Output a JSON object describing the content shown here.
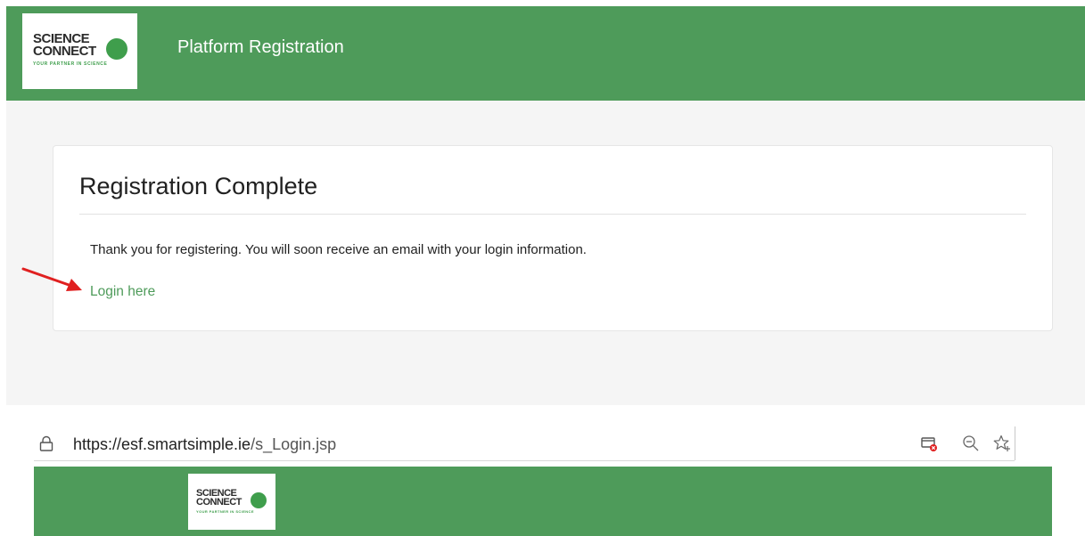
{
  "registration_page": {
    "header_title": "Platform Registration",
    "logo": {
      "line1": "SCIENCE",
      "line2": "CONNECT",
      "tagline": "YOUR PARTNER IN SCIENCE"
    },
    "card": {
      "title": "Registration Complete",
      "message": "Thank you for registering. You will soon receive an email with your login information.",
      "login_link": "Login here"
    },
    "annotation_arrow_color": "#e02020"
  },
  "browser": {
    "url_domain": "https://esf.smartsimple.ie",
    "url_path": "/s_Login.jsp",
    "icons": [
      "lock-icon",
      "blocked-popup-icon",
      "zoom-out-icon",
      "add-favorite-icon"
    ]
  },
  "login_page": {
    "logo": {
      "line1": "SCIENCE",
      "line2": "CONNECT",
      "tagline": "YOUR PARTNER IN SCIENCE"
    }
  },
  "colors": {
    "brand_green": "#4e9b5a",
    "link_green": "#4e9b5a",
    "page_background": "#f5f5f5"
  }
}
